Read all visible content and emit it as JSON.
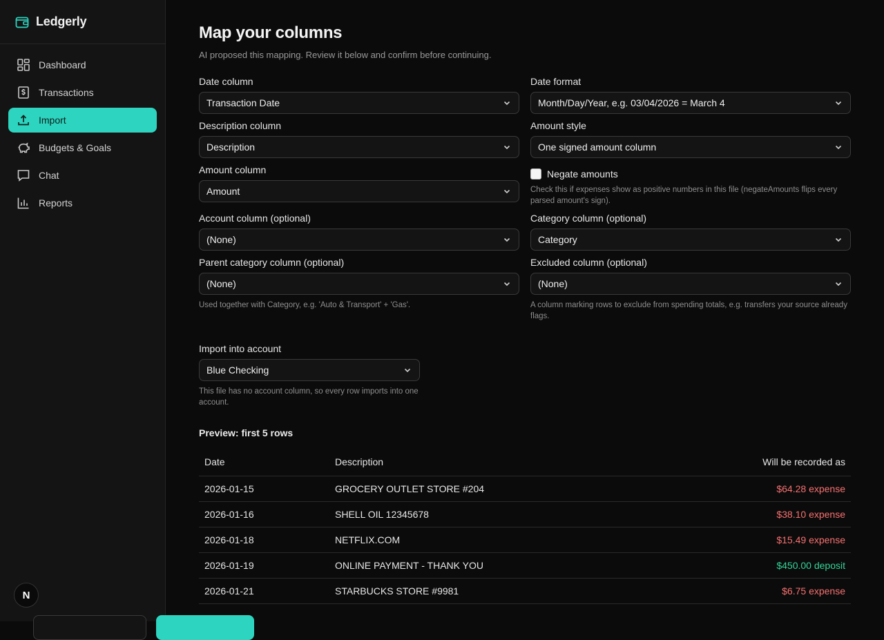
{
  "app": {
    "name": "Ledgerly",
    "accent": "#2dd4bf"
  },
  "sidebar": {
    "items": [
      {
        "label": "Dashboard",
        "icon": "dashboard-icon"
      },
      {
        "label": "Transactions",
        "icon": "receipt-dollar-icon"
      },
      {
        "label": "Import",
        "icon": "upload-icon",
        "active": true
      },
      {
        "label": "Budgets & Goals",
        "icon": "piggy-bank-icon"
      },
      {
        "label": "Chat",
        "icon": "chat-bubble-icon"
      },
      {
        "label": "Reports",
        "icon": "bar-chart-icon"
      }
    ],
    "user_badge": "N"
  },
  "page": {
    "title": "Map your columns",
    "subtitle": "AI proposed this mapping. Review it below and confirm before continuing."
  },
  "fields": {
    "date_column": {
      "label": "Date column",
      "value": "Transaction Date"
    },
    "date_format": {
      "label": "Date format",
      "value": "Month/Day/Year, e.g. 03/04/2026 = March 4"
    },
    "description_column": {
      "label": "Description column",
      "value": "Description"
    },
    "amount_style": {
      "label": "Amount style",
      "value": "One signed amount column"
    },
    "amount_column": {
      "label": "Amount column",
      "value": "Amount"
    },
    "negate": {
      "label": "Negate amounts",
      "checked": false,
      "help": "Check this if expenses show as positive numbers in this file (negateAmounts flips every parsed amount's sign)."
    },
    "account_column": {
      "label": "Account column (optional)",
      "value": "(None)"
    },
    "category_column": {
      "label": "Category column (optional)",
      "value": "Category"
    },
    "parent_category_column": {
      "label": "Parent category column (optional)",
      "value": "(None)",
      "help": "Used together with Category, e.g. 'Auto & Transport' + 'Gas'."
    },
    "excluded_column": {
      "label": "Excluded column (optional)",
      "value": "(None)",
      "help": "A column marking rows to exclude from spending totals, e.g. transfers your source already flags."
    },
    "import_account": {
      "label": "Import into account",
      "value": "Blue Checking",
      "help": "This file has no account column, so every row imports into one account."
    }
  },
  "preview": {
    "title": "Preview: first 5 rows",
    "headers": {
      "date": "Date",
      "description": "Description",
      "recorded": "Will be recorded as"
    },
    "rows": [
      {
        "date": "2026-01-15",
        "description": "GROCERY OUTLET STORE #204",
        "recorded": "$64.28 expense",
        "kind": "expense"
      },
      {
        "date": "2026-01-16",
        "description": "SHELL OIL 12345678",
        "recorded": "$38.10 expense",
        "kind": "expense"
      },
      {
        "date": "2026-01-18",
        "description": "NETFLIX.COM",
        "recorded": "$15.49 expense",
        "kind": "expense"
      },
      {
        "date": "2026-01-19",
        "description": "ONLINE PAYMENT - THANK YOU",
        "recorded": "$450.00 deposit",
        "kind": "deposit"
      },
      {
        "date": "2026-01-21",
        "description": "STARBUCKS STORE #9981",
        "recorded": "$6.75 expense",
        "kind": "expense"
      }
    ]
  }
}
